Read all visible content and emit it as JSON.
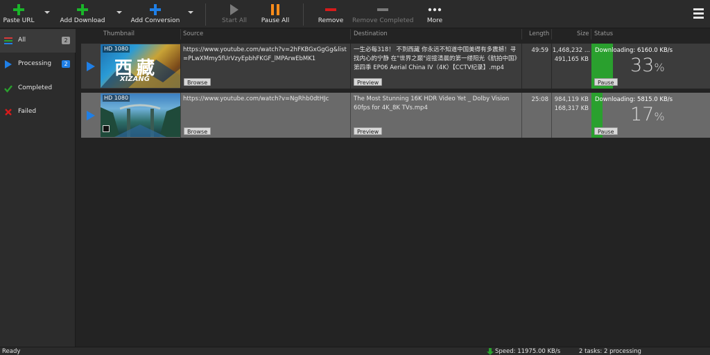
{
  "toolbar": {
    "paste_url": "Paste URL",
    "add_download": "Add Download",
    "add_conversion": "Add Conversion",
    "start_all": "Start All",
    "pause_all": "Pause All",
    "remove": "Remove",
    "remove_completed": "Remove Completed",
    "more": "More",
    "icon_colors": {
      "paste_url": "#1ab52a",
      "add_download": "#1ab52a",
      "add_conversion": "#1f7fe6",
      "pause_all": "#ff8c1a",
      "remove": "#d81b1b"
    }
  },
  "sidebar": {
    "items": [
      {
        "label": "All",
        "count": "2",
        "icon": "all-list-icon"
      },
      {
        "label": "Processing",
        "count": "2",
        "icon": "play-icon"
      },
      {
        "label": "Completed",
        "count": "",
        "icon": "checkmark-icon"
      },
      {
        "label": "Failed",
        "count": "",
        "icon": "x-icon"
      }
    ]
  },
  "table": {
    "headers": {
      "thumbnail": "Thumbnail",
      "source": "Source",
      "destination": "Destination",
      "length": "Length",
      "size": "Size",
      "status": "Status"
    },
    "rows": [
      {
        "hd_tag": "HD 1080",
        "thumb_text": "西藏",
        "thumb_text2": "XIZANG",
        "source_url": "https://www.youtube.com/watch?v=2hFKBGxGgGg&list=PLwXMmy5fUrVzyEpbhFKGF_lMPArwEbMK1",
        "browse": "Browse",
        "destination": "一生必每318！ 不到西藏 你永远不知道中国美得有多震撼！寻找内心的宁静 在\"世界之巅\"迎接清晨的第一缕阳光《航拍中国》第四季 EP06 Aerial China IV（4K）【CCTV纪录】.mp4",
        "preview": "Preview",
        "length": "49:59",
        "size_total": "1,468,232 ...",
        "size_done": "491,165 KB",
        "status_text": "Downloading: 6160.0 KB/s",
        "progress_pct": 33,
        "progress_label": "33",
        "pause": "Pause"
      },
      {
        "hd_tag": "HD 1080",
        "thumb_text": "",
        "thumb_text2": "",
        "source_url": "https://www.youtube.com/watch?v=NgRhb0dtHJc",
        "browse": "Browse",
        "destination": "The Most Stunning 16K HDR Video Yet _ Dolby Vision 60fps for 4K_8K TVs.mp4",
        "preview": "Preview",
        "length": "25:08",
        "size_total": "984,119 KB",
        "size_done": "168,317 KB",
        "status_text": "Downloading: 5815.0 KB/s",
        "progress_pct": 17,
        "progress_label": "17",
        "pause": "Pause"
      }
    ]
  },
  "statusbar": {
    "ready": "Ready",
    "speed": "Speed: 11975.00 KB/s",
    "tasks": "2 tasks: 2 processing"
  }
}
